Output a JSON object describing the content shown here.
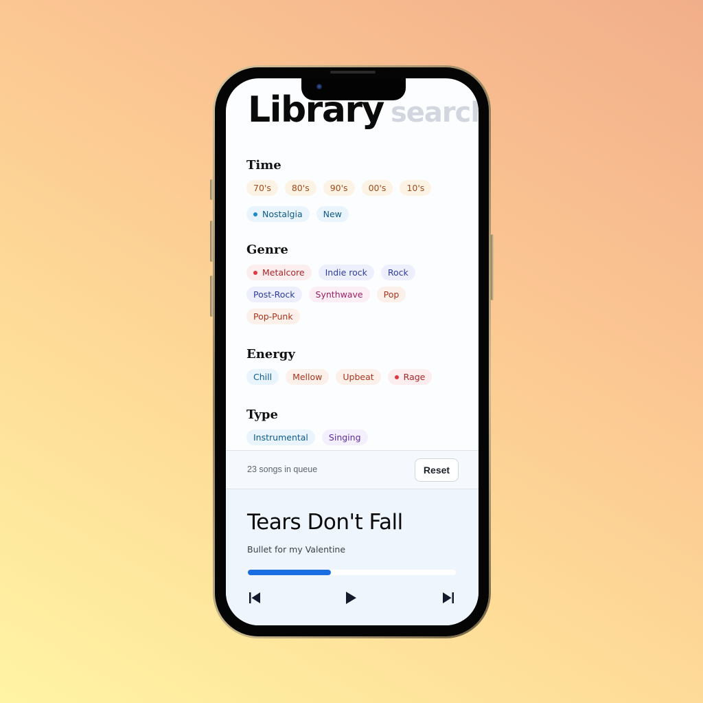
{
  "header": {
    "title": "Library",
    "search_label": "search"
  },
  "sections": [
    {
      "title": "Time",
      "chips": [
        {
          "label": "70's",
          "color": "#a34a1a",
          "bg": "#fcf3e4",
          "dot": false
        },
        {
          "label": "80's",
          "color": "#a34a1a",
          "bg": "#fcf3e4",
          "dot": false
        },
        {
          "label": "90's",
          "color": "#a34a1a",
          "bg": "#fcf3e4",
          "dot": false
        },
        {
          "label": "00's",
          "color": "#a34a1a",
          "bg": "#fcf3e4",
          "dot": false
        },
        {
          "label": "10's",
          "color": "#a34a1a",
          "bg": "#fcf3e4",
          "dot": false
        },
        {
          "label": "Nostalgia",
          "color": "#0e5a86",
          "bg": "#e9f4fc",
          "dot": true,
          "dot_color": "#1b8ad1"
        },
        {
          "label": "New",
          "color": "#0e5a86",
          "bg": "#e9f4fc",
          "dot": false
        }
      ]
    },
    {
      "title": "Genre",
      "chips": [
        {
          "label": "Metalcore",
          "color": "#a8262a",
          "bg": "#fcedee",
          "dot": true,
          "dot_color": "#e0383f"
        },
        {
          "label": "Indie rock",
          "color": "#2d3b9a",
          "bg": "#edf0fc",
          "dot": false
        },
        {
          "label": "Rock",
          "color": "#2d3b9a",
          "bg": "#edf0fc",
          "dot": false
        },
        {
          "label": "Post-Rock",
          "color": "#2d3b9a",
          "bg": "#edf0fc",
          "dot": false
        },
        {
          "label": "Synthwave",
          "color": "#9a1f63",
          "bg": "#fbeef5",
          "dot": false
        },
        {
          "label": "Pop",
          "color": "#a8341e",
          "bg": "#fcf1ea",
          "dot": false
        },
        {
          "label": "Pop-Punk",
          "color": "#a8341e",
          "bg": "#fcf1ea",
          "dot": false
        }
      ]
    },
    {
      "title": "Energy",
      "chips": [
        {
          "label": "Chill",
          "color": "#0e5a86",
          "bg": "#e9f4fc",
          "dot": false
        },
        {
          "label": "Mellow",
          "color": "#a8341e",
          "bg": "#fcf1ea",
          "dot": false
        },
        {
          "label": "Upbeat",
          "color": "#a8341e",
          "bg": "#fcf1ea",
          "dot": false
        },
        {
          "label": "Rage",
          "color": "#a8262a",
          "bg": "#fcedee",
          "dot": true,
          "dot_color": "#e0383f"
        }
      ]
    },
    {
      "title": "Type",
      "chips": [
        {
          "label": "Instrumental",
          "color": "#0e5a86",
          "bg": "#e9f4fc",
          "dot": false
        },
        {
          "label": "Singing",
          "color": "#5b2f9e",
          "bg": "#f4effc",
          "dot": false
        }
      ]
    }
  ],
  "queue": {
    "status_text": "23 songs in queue",
    "reset_label": "Reset"
  },
  "player": {
    "song_title": "Tears Don't Fall",
    "artist": "Bullet for my Valentine",
    "progress_percent": 40,
    "accent_color": "#1a6de0",
    "controls": [
      {
        "name": "previous",
        "icon": "skip-previous-icon"
      },
      {
        "name": "play",
        "icon": "play-icon"
      },
      {
        "name": "next",
        "icon": "skip-next-icon"
      }
    ]
  }
}
